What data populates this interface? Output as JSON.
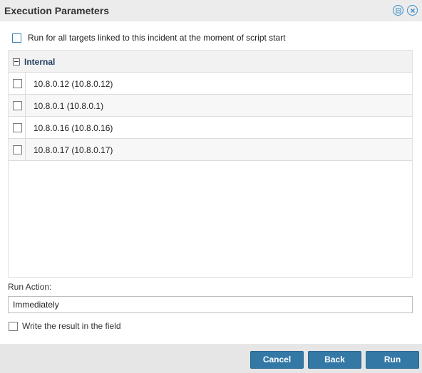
{
  "dialog": {
    "title": "Execution Parameters",
    "icons": [
      "minimize-icon",
      "close-icon"
    ]
  },
  "run_all": {
    "label": "Run for all targets linked to this incident at the moment of script start",
    "checked": false
  },
  "tree": {
    "group_label": "Internal",
    "items": [
      {
        "label": "10.8.0.12 (10.8.0.12)",
        "checked": false
      },
      {
        "label": "10.8.0.1 (10.8.0.1)",
        "checked": false
      },
      {
        "label": "10.8.0.16 (10.8.0.16)",
        "checked": false
      },
      {
        "label": "10.8.0.17 (10.8.0.17)",
        "checked": false
      }
    ]
  },
  "run_action": {
    "label": "Run Action:",
    "value": "Immediately"
  },
  "write_result": {
    "label": "Write the result in the field",
    "checked": false
  },
  "buttons": {
    "cancel": "Cancel",
    "back": "Back",
    "run": "Run"
  },
  "colors": {
    "accent": "#3478a6",
    "icon_blue": "#3b8ec8",
    "group_text": "#1f3d5c"
  }
}
